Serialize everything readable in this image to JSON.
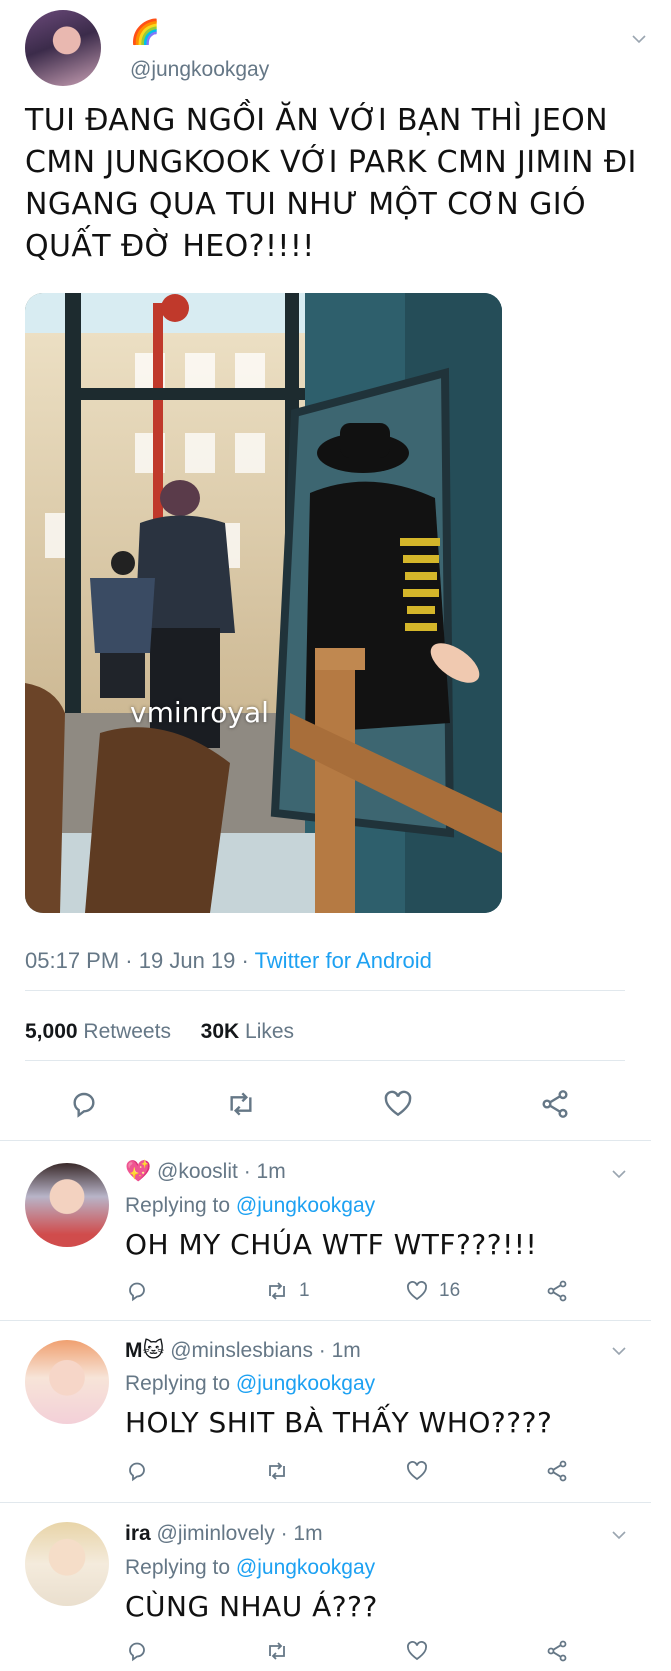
{
  "main_tweet": {
    "name_emoji": "🌈",
    "handle": "@jungkookgay",
    "text": "TUI ĐANG NGỒI ĂN VỚI BẠN THÌ JEON CMN JUNGKOOK VỚI PARK CMN JIMIN ĐI NGANG QUA TUI NHƯ MỘT CƠN GIÓ QUẤT ĐỜ HEO?!!!!",
    "photo_watermark": "vminroyal",
    "time": "05:17 PM",
    "date": "19 Jun 19",
    "source": "Twitter for Android",
    "retweets_count": "5,000",
    "retweets_label": "Retweets",
    "likes_count": "30K",
    "likes_label": "Likes",
    "actions": [
      "reply-icon",
      "retweet-icon",
      "like-icon",
      "share-icon"
    ]
  },
  "replies": [
    {
      "name": "💖",
      "handle": "@kooslit",
      "time": "1m",
      "replying_prefix": "Replying to",
      "replying_to": "@jungkookgay",
      "text": "OH MY CHÚA WTF WTF???!!!",
      "retweets": "1",
      "likes": "16"
    },
    {
      "name": "M🐱",
      "handle": "@minslesbians",
      "time": "1m",
      "replying_prefix": "Replying to",
      "replying_to": "@jungkookgay",
      "text": "HOLY SHIT BÀ THẤY WHO????",
      "retweets": "",
      "likes": ""
    },
    {
      "name": "ira",
      "handle": "@jiminlovely",
      "time": "1m",
      "replying_prefix": "Replying to",
      "replying_to": "@jungkookgay",
      "text": "CÙNG NHAU Á???",
      "retweets": "",
      "likes": ""
    }
  ],
  "colors": {
    "link_blue": "#1da1f2",
    "muted_gray": "#657786",
    "divider": "#e1e8ed"
  }
}
